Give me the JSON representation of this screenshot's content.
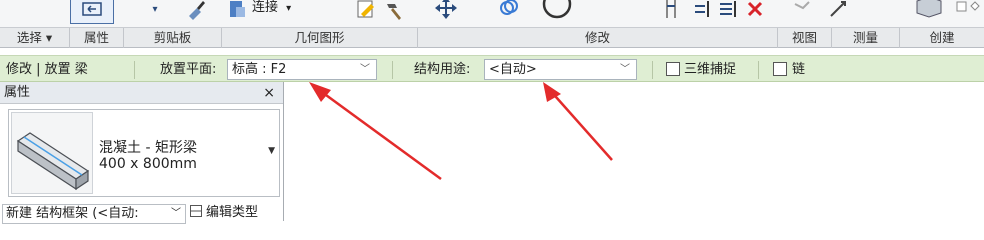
{
  "ribbon": {
    "tools": {
      "connect_label": "连接",
      "connect_arrow": "▾",
      "small_arrow": "▾"
    },
    "panels": [
      "选择 ▾",
      "属性",
      "剪贴板",
      "几何图形",
      "修改",
      "视图",
      "测量",
      "创建"
    ]
  },
  "options_bar": {
    "context_label": "修改 | 放置 梁",
    "placement_plane_label": "放置平面:",
    "placement_plane_value": "标高 : F2",
    "structural_usage_label": "结构用途:",
    "structural_usage_value": "<自动>",
    "three_d_snapping_label": "三维捕捉",
    "chain_label": "链"
  },
  "properties": {
    "title": "属性",
    "close": "×",
    "type_name": "混凝土 - 矩形梁",
    "type_size": "400 x 800mm",
    "new_instance_label": "新建 结构框架 (<自动:",
    "edit_type_label": "编辑类型"
  },
  "colors": {
    "option_bar_bg": "#dfeed3",
    "arrow_red": "#e32b2b",
    "ribbon_bg": "#f5f6f7"
  }
}
